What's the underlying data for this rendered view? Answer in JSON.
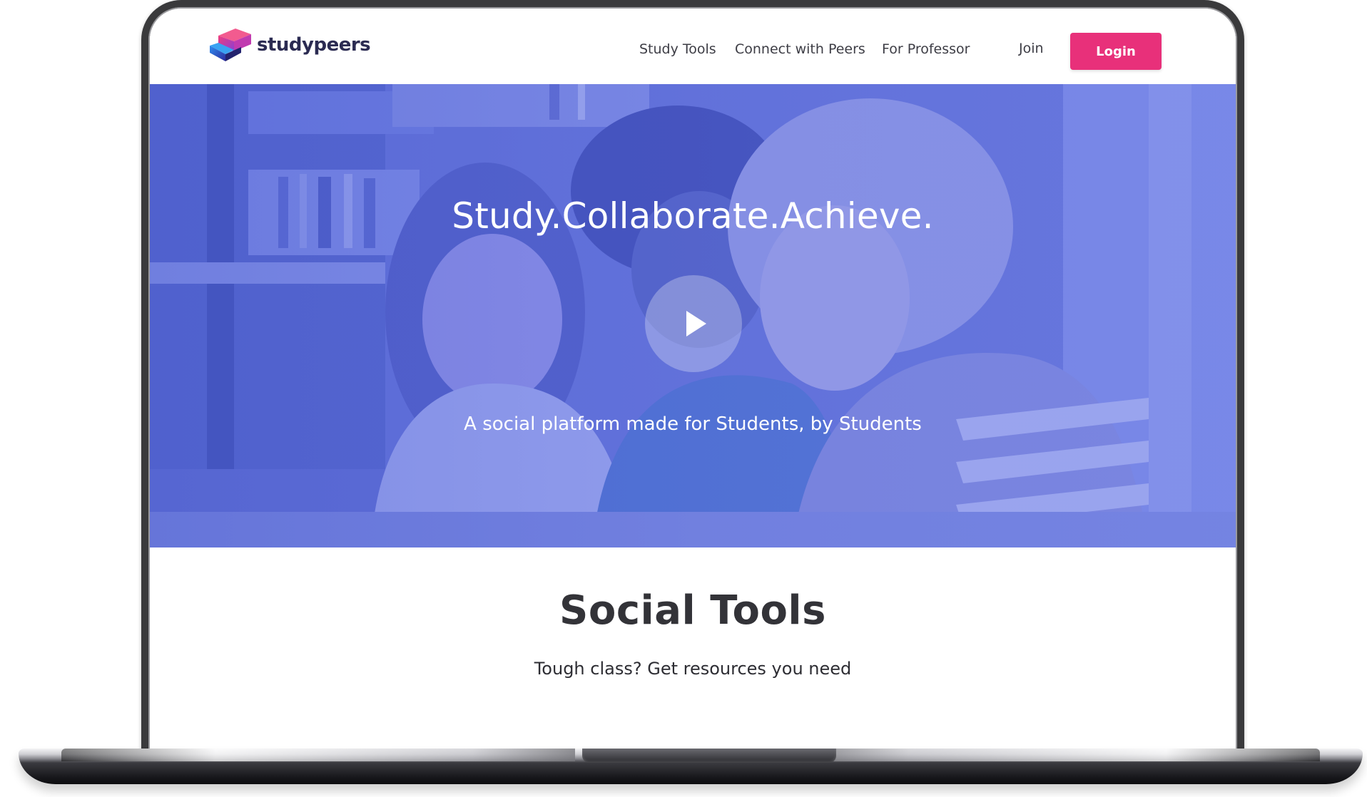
{
  "brand": {
    "name": "studypeers",
    "primary_color": "#e8307a",
    "hero_color": "#6373db",
    "text_dark": "#2b2b52"
  },
  "header": {
    "nav": [
      {
        "label": "Study Tools"
      },
      {
        "label": "Connect with Peers"
      },
      {
        "label": "For Professor"
      },
      {
        "label": "Join"
      }
    ],
    "login_label": "Login"
  },
  "hero": {
    "title": "Study.Collaborate.Achieve.",
    "subtitle": "A social platform made for Students, by Students",
    "play_icon": "play-icon"
  },
  "section": {
    "title": "Social Tools",
    "subtitle": "Tough class? Get resources you need"
  }
}
